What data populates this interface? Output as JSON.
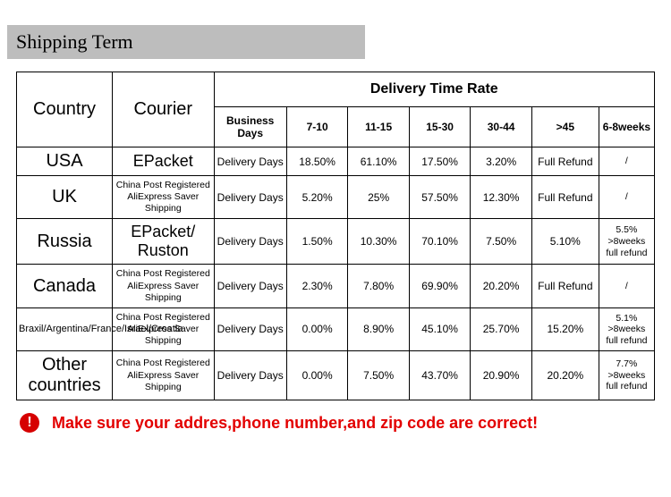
{
  "section_title": "Shipping Term",
  "table": {
    "headers": {
      "country": "Country",
      "courier": "Courier",
      "delivery_time": "Delivery Time Rate",
      "business_days": "Business Days",
      "cols": [
        "7-10",
        "11-15",
        "15-30",
        "30-44",
        ">45",
        "6-8weeks"
      ]
    },
    "rows": [
      {
        "country": "USA",
        "country_small": false,
        "courier": "EPacket",
        "courier_small": false,
        "label": "Delivery Days",
        "cells": [
          "18.50%",
          "61.10%",
          "17.50%",
          "3.20%",
          "Full Refund",
          "/"
        ]
      },
      {
        "country": "UK",
        "country_small": false,
        "courier": "China Post Registered AliExpress Saver Shipping",
        "courier_small": true,
        "label": "Delivery Days",
        "cells": [
          "5.20%",
          "25%",
          "57.50%",
          "12.30%",
          "Full Refund",
          "/"
        ]
      },
      {
        "country": "Russia",
        "country_small": false,
        "courier": "EPacket/ Ruston",
        "courier_small": false,
        "label": "Delivery Days",
        "cells": [
          "1.50%",
          "10.30%",
          "70.10%",
          "7.50%",
          "5.10%",
          "5.5% >8weeks full refund"
        ]
      },
      {
        "country": "Canada",
        "country_small": false,
        "courier": "China Post Registered AliExpress Saver Shipping",
        "courier_small": true,
        "label": "Delivery Days",
        "cells": [
          "2.30%",
          "7.80%",
          "69.90%",
          "20.20%",
          "Full Refund",
          "/"
        ]
      },
      {
        "country": "Braxil/Argentina/France/Israel/Croatia",
        "country_small": true,
        "courier": "China Post Registered AliExpress Saver Shipping",
        "courier_small": true,
        "label": "Delivery Days",
        "cells": [
          "0.00%",
          "8.90%",
          "45.10%",
          "25.70%",
          "15.20%",
          "5.1% >8weeks full refund"
        ]
      },
      {
        "country": "Other countries",
        "country_small": false,
        "courier": "China Post Registered AliExpress Saver Shipping",
        "courier_small": true,
        "label": "Delivery Days",
        "cells": [
          "0.00%",
          "7.50%",
          "43.70%",
          "20.90%",
          "20.20%",
          "7.7% >8weeks full refund"
        ]
      }
    ]
  },
  "warning": "Make sure your addres,phone number,and zip code are correct!"
}
